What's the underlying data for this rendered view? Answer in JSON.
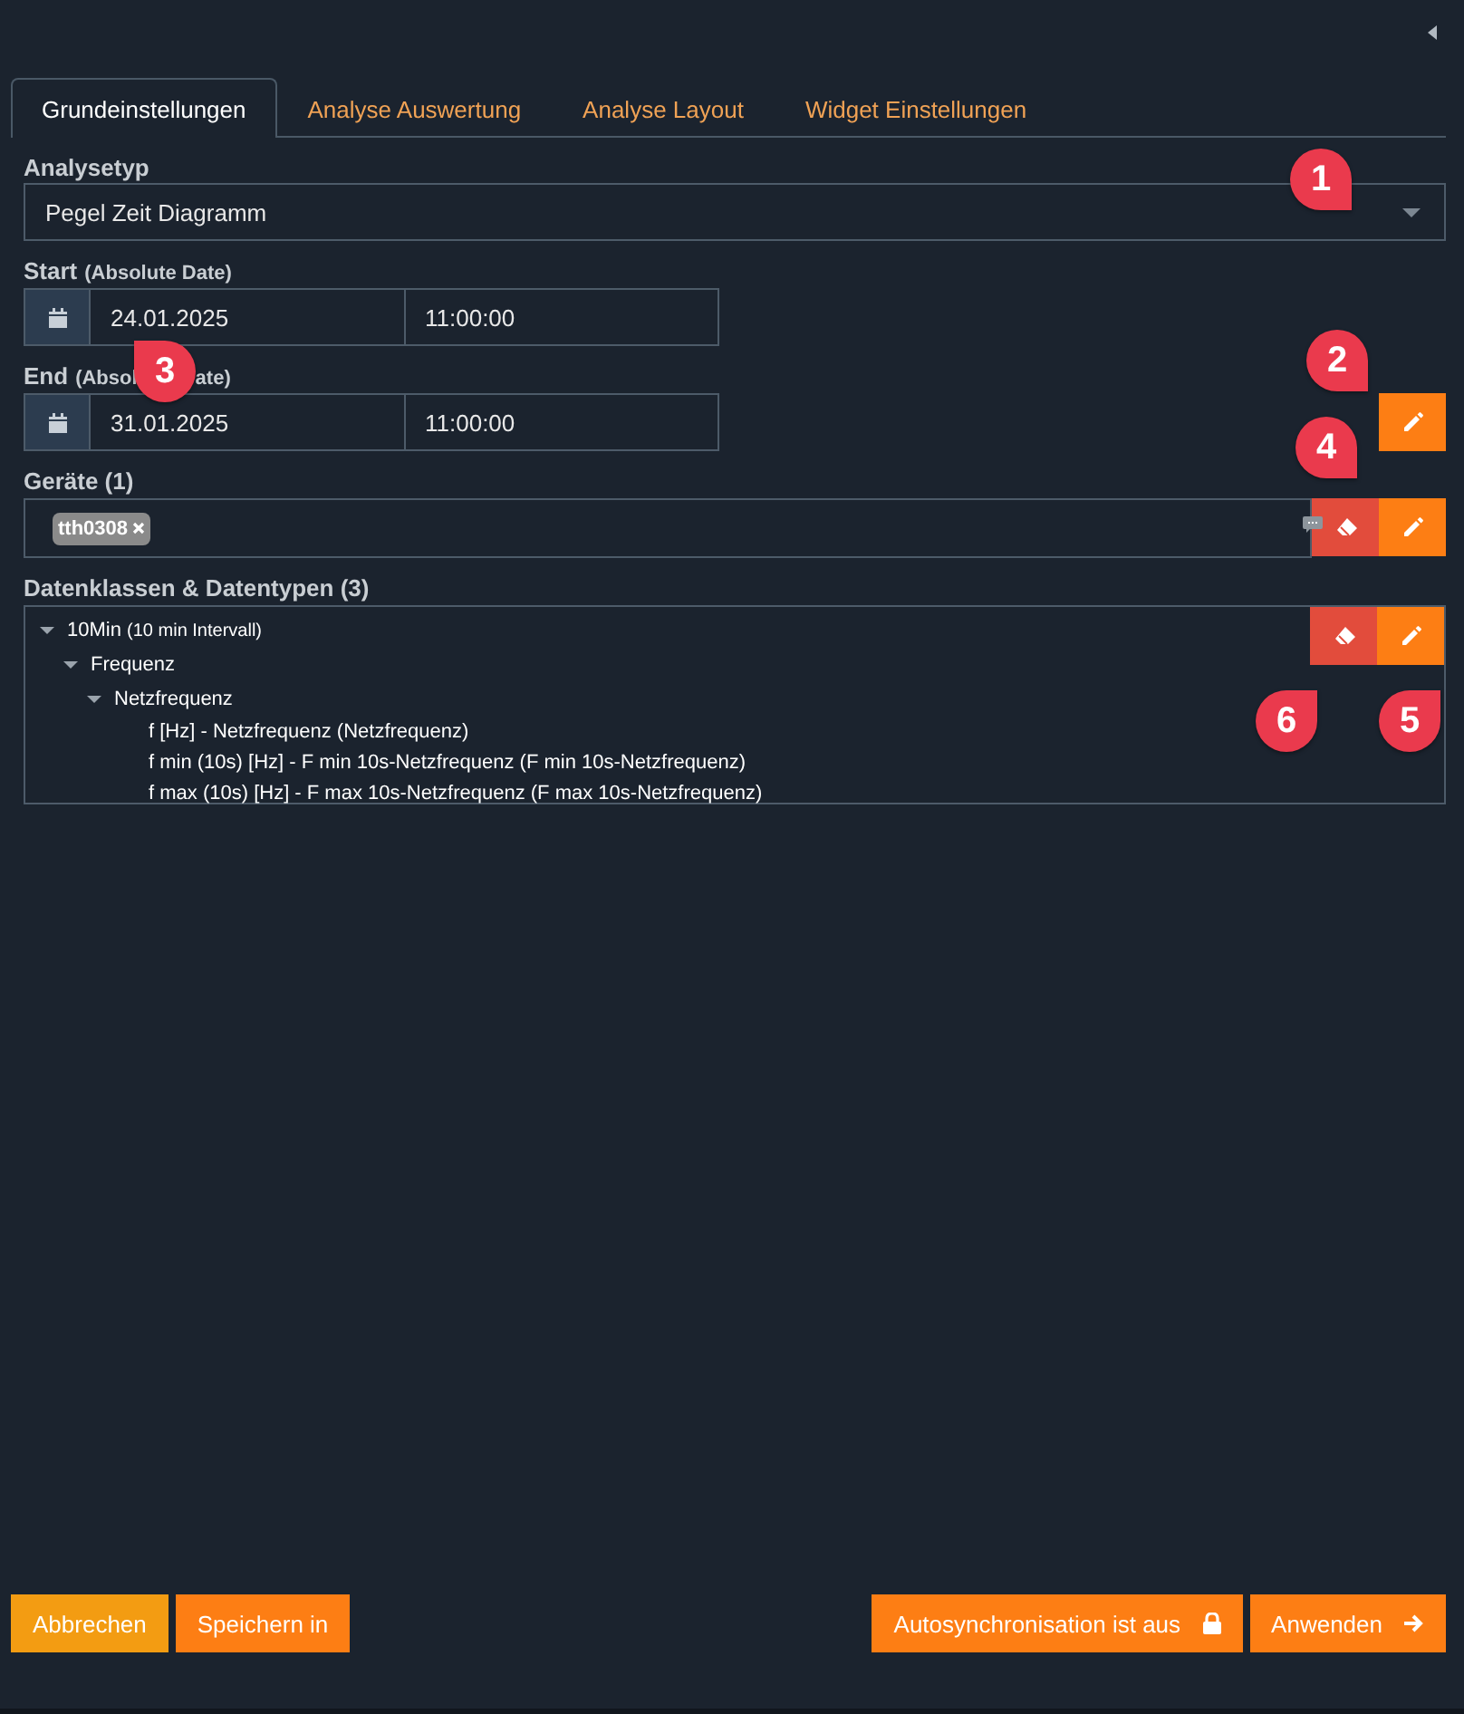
{
  "tabs": [
    {
      "label": "Grundeinstellungen",
      "selected": true
    },
    {
      "label": "Analyse Auswertung",
      "selected": false
    },
    {
      "label": "Analyse Layout",
      "selected": false
    },
    {
      "label": "Widget Einstellungen",
      "selected": false
    }
  ],
  "analysis_type": {
    "label": "Analysetyp",
    "value": "Pegel Zeit Diagramm"
  },
  "start": {
    "label": "Start",
    "note": "(Absolute Date)",
    "date": "24.01.2025",
    "time": "11:00:00"
  },
  "end": {
    "label": "End",
    "note": [
      "(Absol",
      "ate)"
    ],
    "date": "31.01.2025",
    "time": "11:00:00"
  },
  "devices": {
    "label": "Geräte (1)",
    "tags": [
      "tth0308"
    ]
  },
  "data_classes": {
    "label": "Datenklassen & Datentypen (3)",
    "tree": [
      {
        "label": "10Min",
        "note": "(10 min Intervall)",
        "expanded": true,
        "children": [
          {
            "label": "Frequenz",
            "expanded": true,
            "children": [
              {
                "label": "Netzfrequenz",
                "expanded": true,
                "children": [
                  {
                    "label": "f [Hz] - Netzfrequenz (Netzfrequenz)"
                  },
                  {
                    "label": "f min (10s) [Hz] - F min 10s-Netzfrequenz (F min 10s-Netzfrequenz)"
                  },
                  {
                    "label": "f max (10s) [Hz] - F max 10s-Netzfrequenz (F max 10s-Netzfrequenz)"
                  }
                ]
              }
            ]
          }
        ]
      }
    ]
  },
  "footer_left": [
    {
      "label": "Abbrechen",
      "kind": "cancel"
    },
    {
      "label": "Speichern in",
      "kind": "save"
    }
  ],
  "footer_right": [
    {
      "label": "Autosynchronisation ist aus",
      "kind": "lock"
    },
    {
      "label": "Anwenden",
      "kind": "apply"
    }
  ],
  "callouts": [
    {
      "number": "1",
      "kind": "down-right"
    },
    {
      "number": "2",
      "kind": "down-right"
    },
    {
      "number": "3",
      "kind": "up-left"
    },
    {
      "number": "4",
      "kind": "down-right"
    },
    {
      "number": "5",
      "kind": "up-right"
    },
    {
      "number": "6",
      "kind": "up-right"
    }
  ]
}
